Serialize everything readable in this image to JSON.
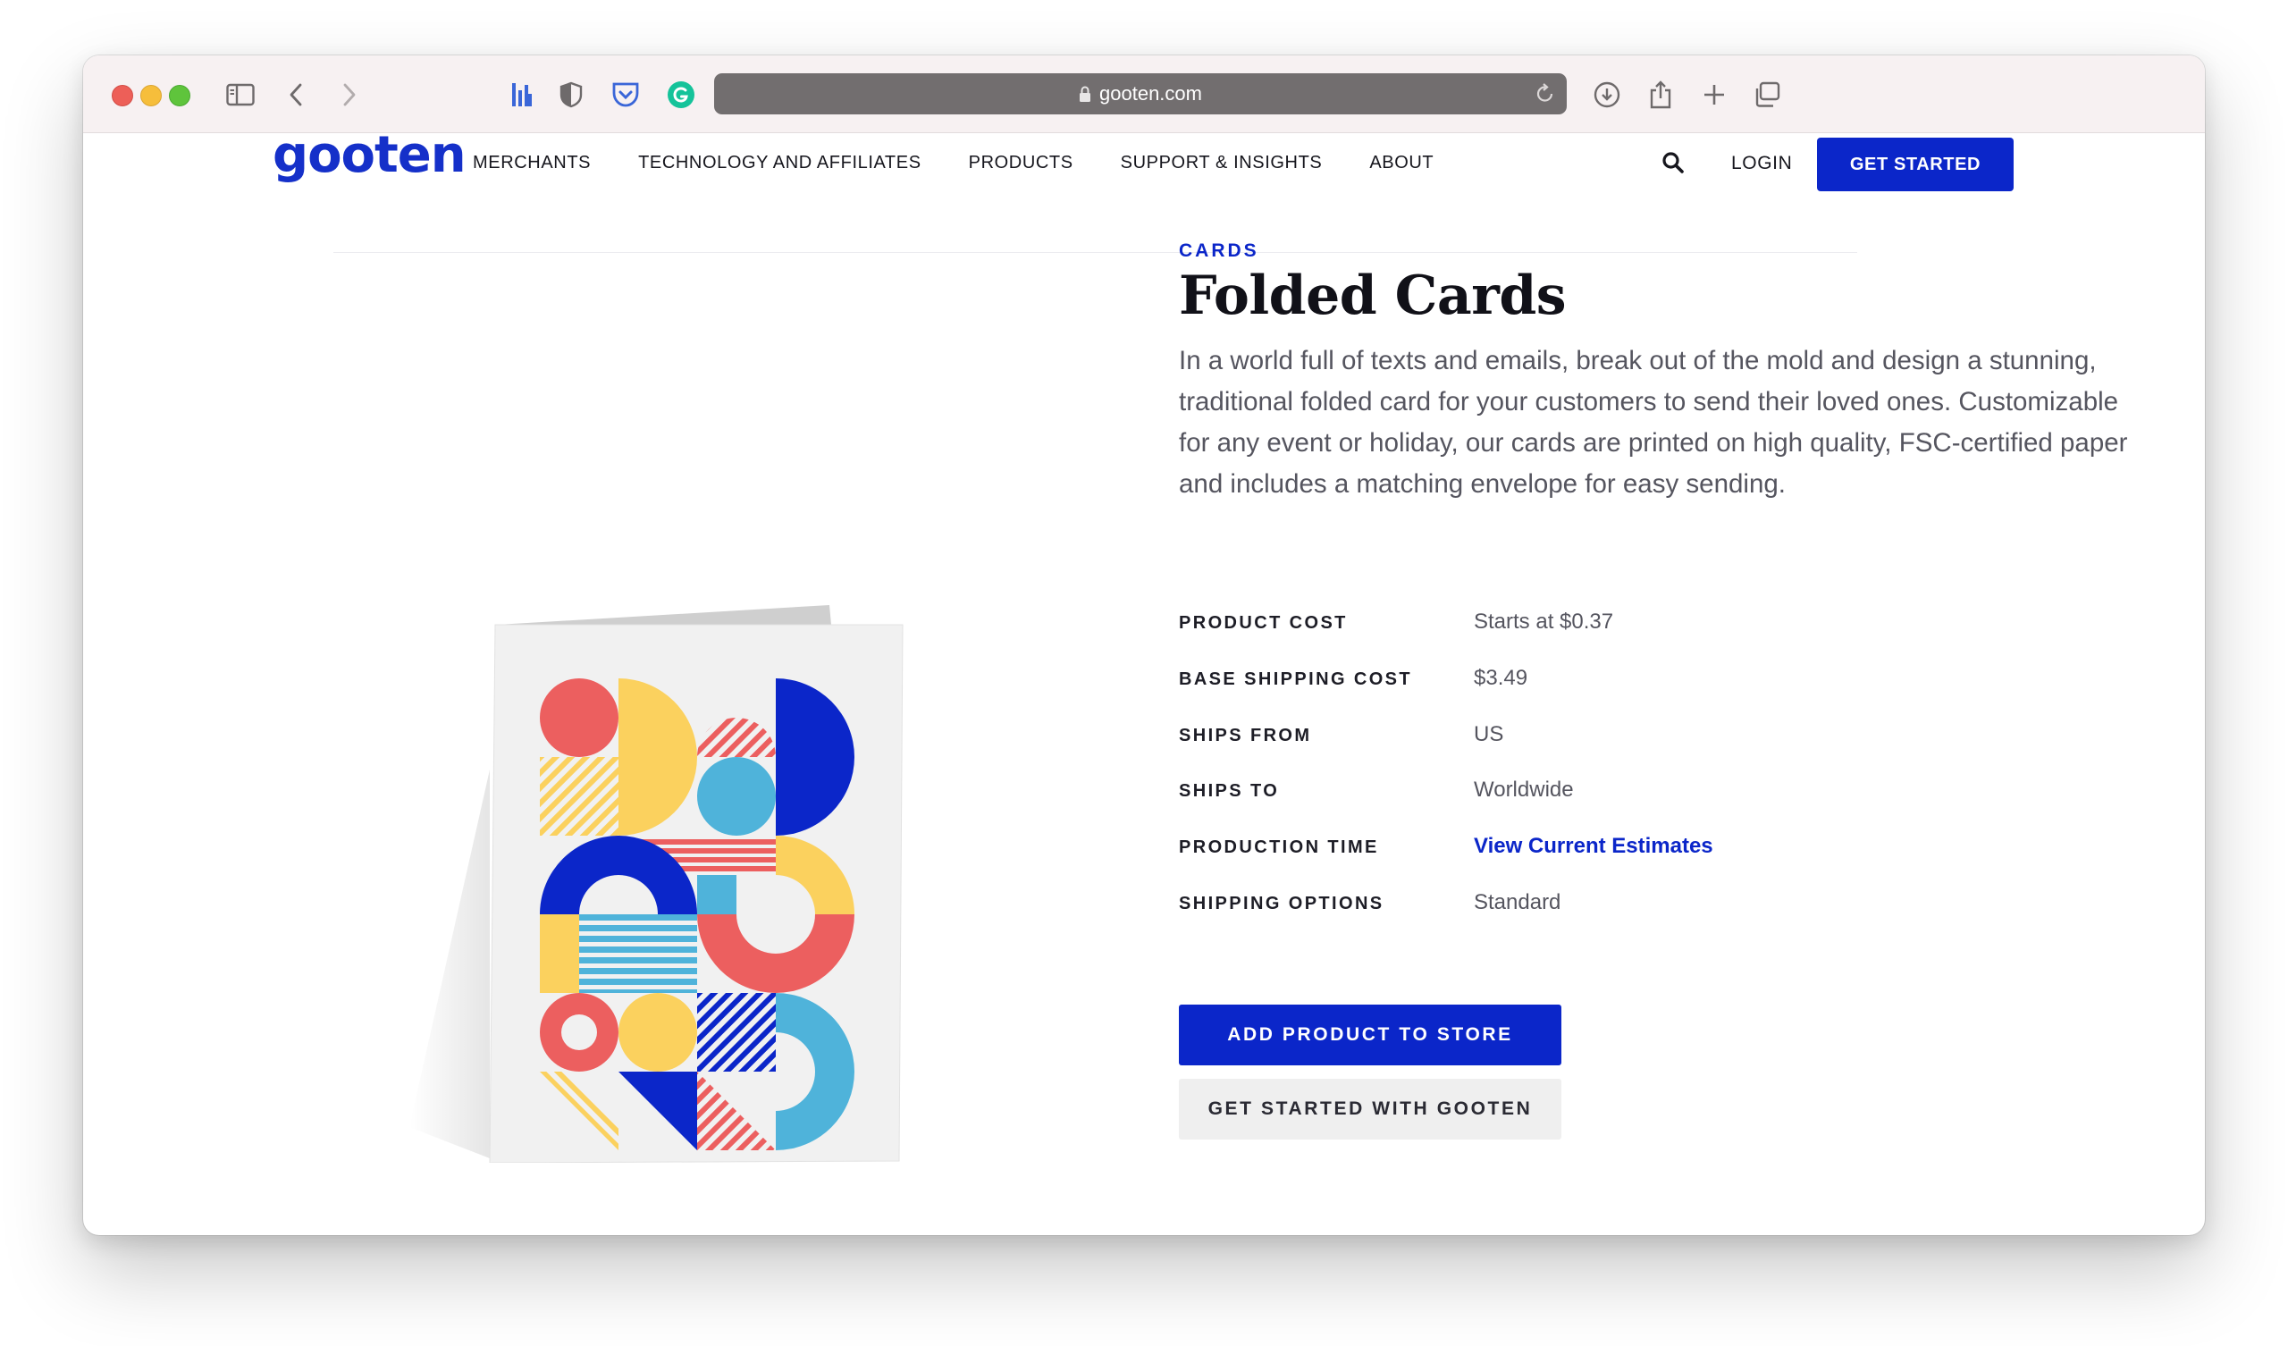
{
  "browser": {
    "url": "gooten.com",
    "traffic_lights": [
      "close",
      "minimize",
      "zoom"
    ],
    "toolbar_icons": [
      "sidebar-icon",
      "back-icon",
      "forward-icon",
      "extension-bars-icon",
      "shield-icon",
      "pocket-icon",
      "grammarly-icon",
      "download-icon",
      "share-icon",
      "new-tab-icon",
      "tab-overview-icon"
    ]
  },
  "nav": {
    "logo": "gooten",
    "links": [
      "MERCHANTS",
      "TECHNOLOGY AND AFFILIATES",
      "PRODUCTS",
      "SUPPORT & INSIGHTS",
      "ABOUT"
    ],
    "login": "LOGIN",
    "cta": "GET STARTED"
  },
  "product": {
    "category": "CARDS",
    "title": "Folded Cards",
    "description": "In a world full of texts and emails, break out of the mold and design a stunning, traditional folded card for your customers to send their loved ones. Customizable for any event or holiday, our cards are printed on high quality, FSC-certified paper and includes a matching envelope for easy sending.",
    "specs": [
      {
        "label": "PRODUCT COST",
        "value": "Starts at $0.37"
      },
      {
        "label": "BASE SHIPPING COST",
        "value": "$3.49"
      },
      {
        "label": "SHIPS FROM",
        "value": "US"
      },
      {
        "label": "SHIPS TO",
        "value": "Worldwide"
      },
      {
        "label": "PRODUCTION TIME",
        "value": "View Current Estimates"
      },
      {
        "label": "SHIPPING OPTIONS",
        "value": "Standard"
      }
    ],
    "actions": {
      "primary": "ADD PRODUCT TO STORE",
      "secondary": "GET STARTED WITH GOOTEN"
    }
  },
  "colors": {
    "brand_blue": "#0b26c9",
    "card_red": "#ec5f5f",
    "card_yellow": "#fbd15e",
    "card_light_blue": "#4fb3da",
    "card_dark_blue": "#0b26c9"
  }
}
